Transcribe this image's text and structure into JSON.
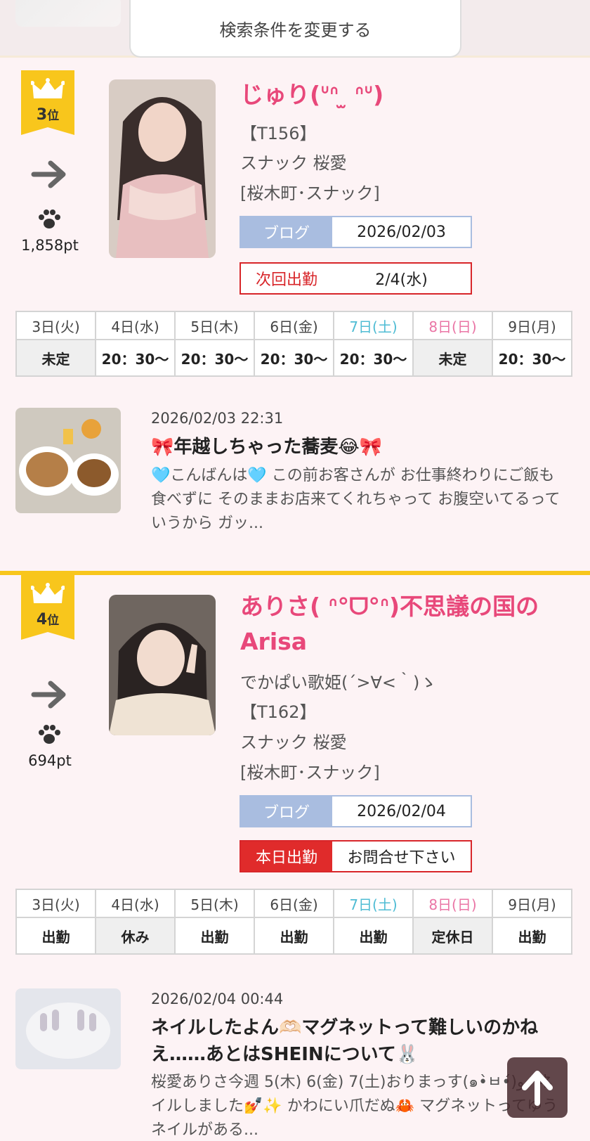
{
  "search": {
    "button_label": "検索条件を変更する"
  },
  "cards": [
    {
      "rank": "3",
      "rank_suffix": "位",
      "points": "1,858pt",
      "name": "じゅり(ᐡᐢ ̫ ᐢᐡ)",
      "tag": "【T156】",
      "shop": "スナック 桜愛",
      "area": "[桜木町･スナック]",
      "blog_label": "ブログ",
      "blog_date": "2026/02/03",
      "next_label": "次回出勤",
      "next_value": "2/4(水)",
      "days": [
        "3日(火)",
        "4日(水)",
        "5日(木)",
        "6日(金)",
        "7日(土)",
        "8日(日)",
        "9日(月)"
      ],
      "times": [
        "未定",
        "20：30〜",
        "20：30〜",
        "20：30〜",
        "20：30〜",
        "未定",
        "20：30〜"
      ],
      "post": {
        "date": "2026/02/03 22:31",
        "title": "🎀年越しちゃった蕎麦😂🎀",
        "body": "🩵こんばんは🩵 この前お客さんが お仕事終わりにご飯も食べずに そのままお店来てくれちゃって お腹空いてるっていうから ガッ..."
      }
    },
    {
      "rank": "4",
      "rank_suffix": "位",
      "points": "694pt",
      "name": "ありさ( ᐢ°ᗜ°ᐢ)不思議の国のArisa",
      "catch": "でかぱい歌姫(´>∀<｀)ゝ",
      "tag": "【T162】",
      "shop": "スナック 桜愛",
      "area": "[桜木町･スナック]",
      "blog_label": "ブログ",
      "blog_date": "2026/02/04",
      "next_label": "本日出勤",
      "next_value": "お問合せ下さい",
      "days": [
        "3日(火)",
        "4日(水)",
        "5日(木)",
        "6日(金)",
        "7日(土)",
        "8日(日)",
        "9日(月)"
      ],
      "times": [
        "出勤",
        "休み",
        "出勤",
        "出勤",
        "出勤",
        "定休日",
        "出勤"
      ],
      "post": {
        "date": "2026/02/04 00:44",
        "title": "ネイルしたよん🫶🏻マグネットって難しいのかねえ……あとはSHEINについて🐰",
        "body": "桜愛ありさ今週 5(木) 6(金) 7(土)おりまっす(๑•̀ㅂ•́)و✧ネイルしました💅✨ かわにい爪だぬ🦀 マグネットってゆうネイルがある..."
      }
    }
  ],
  "icons": {
    "crown": "crown-icon",
    "arrow": "arrow-right-icon",
    "paw": "paw-icon",
    "to_top": "arrow-up-icon"
  },
  "colors": {
    "rank": "#f8c61c",
    "name": "#e8487a",
    "blog": "#a9bde0",
    "next": "#d8262a",
    "saturday": "#4fbcd4",
    "sunday": "#ea75a5"
  }
}
